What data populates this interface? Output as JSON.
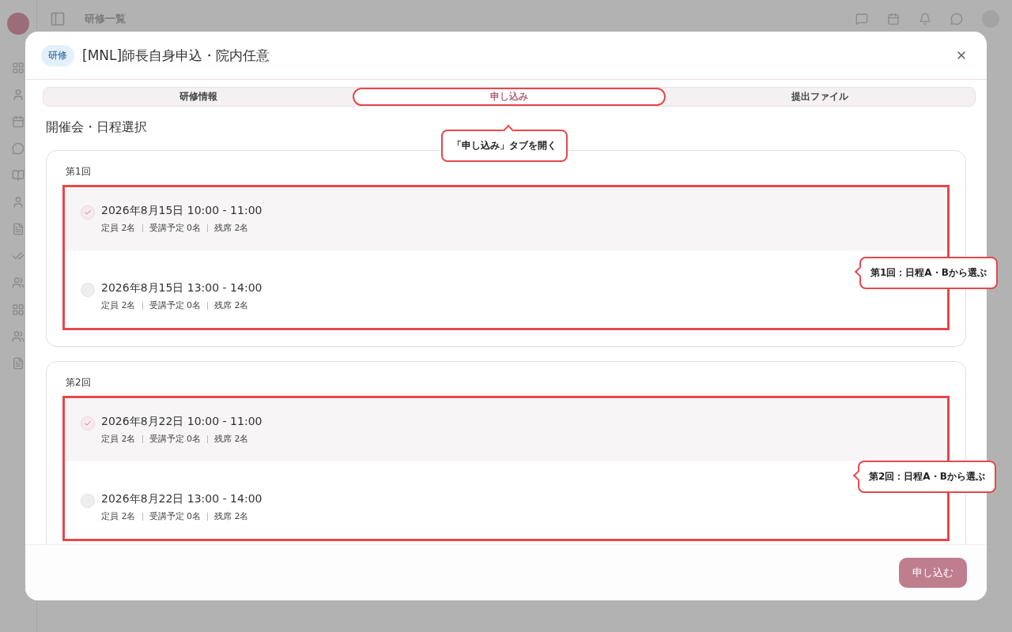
{
  "background": {
    "header_title": "研修一覧"
  },
  "modal": {
    "badge": "研修",
    "title": "[MNL]師長自身申込・院内任意",
    "tabs": [
      {
        "label": "研修情報",
        "selected": false,
        "highlighted": false
      },
      {
        "label": "申し込み",
        "selected": true,
        "highlighted": true
      },
      {
        "label": "提出ファイル",
        "selected": false,
        "highlighted": false
      }
    ],
    "section_title": "開催会・日程選択",
    "sessions": [
      {
        "label": "第1回",
        "highlighted": true,
        "options": [
          {
            "datetime": "2026年8月15日 10:00 - 11:00",
            "capacity": "定員 2名",
            "enrolled": "受講予定 0名",
            "remaining": "残席 2名",
            "selected": true
          },
          {
            "datetime": "2026年8月15日 13:00 - 14:00",
            "capacity": "定員 2名",
            "enrolled": "受講予定 0名",
            "remaining": "残席 2名",
            "selected": false
          }
        ]
      },
      {
        "label": "第2回",
        "highlighted": true,
        "options": [
          {
            "datetime": "2026年8月22日 10:00 - 11:00",
            "capacity": "定員 2名",
            "enrolled": "受講予定 0名",
            "remaining": "残席 2名",
            "selected": true
          },
          {
            "datetime": "2026年8月22日 13:00 - 14:00",
            "capacity": "定員 2名",
            "enrolled": "受講予定 0名",
            "remaining": "残席 2名",
            "selected": false
          }
        ]
      }
    ],
    "submit_button": "申し込む"
  },
  "callouts": [
    {
      "text": "「申し込み」タブを開く",
      "kind": "up"
    },
    {
      "text": "第1回：日程A・Bから選ぶ",
      "kind": "left"
    },
    {
      "text": "第2回：日程A・Bから選ぶ",
      "kind": "left"
    }
  ]
}
